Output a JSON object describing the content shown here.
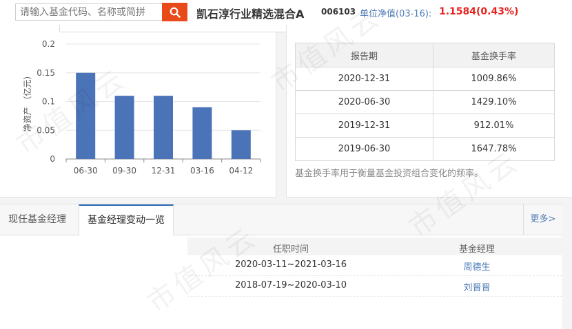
{
  "topbar": {
    "search_placeholder": "请输入基金代码、名称或简拼",
    "fund_name": "凯石淳行业精选混合A",
    "fund_code": "006103",
    "nav_label": "单位净值(03-16):",
    "nav_value": "1.1584(0.43%)"
  },
  "chart_data": {
    "type": "bar",
    "categories": [
      "06-30",
      "09-30",
      "12-31",
      "03-16",
      "04-12"
    ],
    "values": [
      0.15,
      0.11,
      0.11,
      0.09,
      0.05
    ],
    "ylabel": "净资产 （亿元）",
    "ylim": [
      0,
      0.2
    ],
    "yticks": [
      "0",
      "0.05",
      "0.1",
      "0.15",
      "0.2"
    ],
    "color": "#4b73b8",
    "grid": true
  },
  "turnover": {
    "headers": [
      "报告期",
      "基金换手率"
    ],
    "rows": [
      [
        "2020-12-31",
        "1009.86%"
      ],
      [
        "2020-06-30",
        "1429.10%"
      ],
      [
        "2019-12-31",
        "912.01%"
      ],
      [
        "2019-06-30",
        "1647.78%"
      ]
    ],
    "note": "基金换手率用于衡量基金投资组合变化的频率。"
  },
  "managers": {
    "tabs": [
      "现任基金经理",
      "基金经理变动一览"
    ],
    "active_tab": 1,
    "more_label": "更多>",
    "headers": [
      "任职时间",
      "基金经理"
    ],
    "rows": [
      [
        "2020-03-11~2021-03-16",
        "周德生"
      ],
      [
        "2018-07-19~2020-03-10",
        "刘晋晋"
      ]
    ]
  },
  "watermark": "市值风云",
  "colors": {
    "accent": "#e84a1a",
    "link": "#4e7bb6",
    "red": "#e6231f",
    "bar": "#4b73b8"
  }
}
